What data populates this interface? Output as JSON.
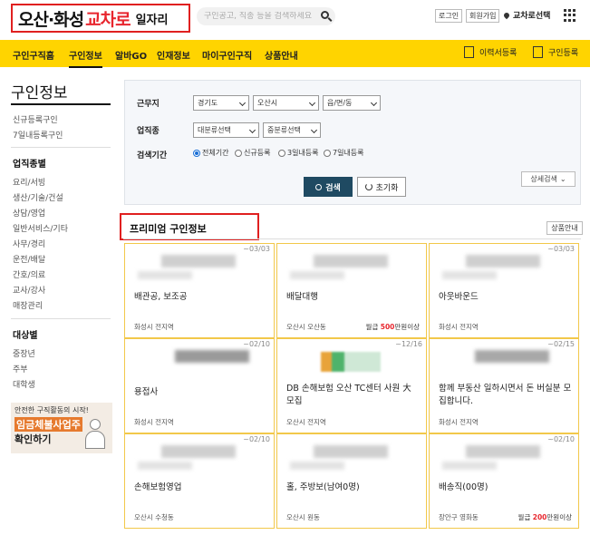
{
  "header": {
    "logo_main": "오산·화성",
    "logo_accent": "교차로",
    "logo_sub": "일자리",
    "search_placeholder": "구인공고, 직종 등을 검색하세요",
    "login": "로그인",
    "signup": "회원가입",
    "location": "교차로선택"
  },
  "nav": {
    "items": [
      "구인구직홈",
      "구인정보",
      "알바GO",
      "인재정보",
      "마이구인구직",
      "상품안내"
    ],
    "active_index": 1,
    "resume_register": "이력서등록",
    "job_register": "구인등록"
  },
  "sidebar": {
    "title": "구인정보",
    "links": [
      "신규등록구인",
      "7일내등록구인"
    ],
    "category_head": "업직종별",
    "categories": [
      "요리/서빙",
      "생산/기술/건설",
      "상담/영업",
      "일반서비스/기타",
      "사무/경리",
      "운전/배달",
      "간호/의료",
      "교사/강사",
      "매장관리"
    ],
    "target_head": "대상별",
    "targets": [
      "중장년",
      "주부",
      "대학생"
    ],
    "banner_line1": "안전한 구직활동의 시작!",
    "banner_line2": "임금체불사업주",
    "banner_line3": "확인하기"
  },
  "filter": {
    "region_label": "근무지",
    "region_1": "경기도",
    "region_2": "오산시",
    "region_3": "읍/면/동",
    "job_label": "업직종",
    "job_1": "대분류선택",
    "job_2": "중분류선택",
    "period_label": "검색기간",
    "periods": [
      "전체기간",
      "신규등록",
      "3일내등록",
      "7일내등록"
    ],
    "search_btn": "검색",
    "reset_btn": "초기화",
    "detail_btn": "상세검색"
  },
  "premium": {
    "title": "프리미엄 구인정보",
    "product_btn": "상품안내",
    "cards": [
      {
        "date": "~03/03",
        "title": "배관공, 보조공",
        "place": "화성시 전지역",
        "pay_prefix": "",
        "pay_amount": "",
        "pay_suffix": ""
      },
      {
        "date": "",
        "title": "배달대행",
        "place": "오산시 오산동",
        "pay_prefix": "월급 ",
        "pay_amount": "500",
        "pay_suffix": "만원이상"
      },
      {
        "date": "~03/03",
        "title": "아웃바운드",
        "place": "화성시 전지역",
        "pay_prefix": "",
        "pay_amount": "",
        "pay_suffix": ""
      },
      {
        "date": "~02/10",
        "title": "용접사",
        "place": "화성시 전지역",
        "pay_prefix": "",
        "pay_amount": "",
        "pay_suffix": ""
      },
      {
        "date": "~12/16",
        "title": "DB 손해보험 오산 TC센터 사원 大 모집",
        "place": "오산시 전지역",
        "pay_prefix": "",
        "pay_amount": "",
        "pay_suffix": ""
      },
      {
        "date": "~02/15",
        "title": "함께 부동산 일하시면서 돈 버실분 모집합니다.",
        "place": "화성시 전지역",
        "pay_prefix": "",
        "pay_amount": "",
        "pay_suffix": ""
      },
      {
        "date": "~02/10",
        "title": "손해보험영업",
        "place": "오산시 수청동",
        "pay_prefix": "",
        "pay_amount": "",
        "pay_suffix": ""
      },
      {
        "date": "",
        "title": "홀, 주방보(남여0명)",
        "place": "오산시 원동",
        "pay_prefix": "",
        "pay_amount": "",
        "pay_suffix": ""
      },
      {
        "date": "~02/10",
        "title": "배송직(00명)",
        "place": "장안구 영화동",
        "pay_prefix": "월급 ",
        "pay_amount": "200",
        "pay_suffix": "만원이상"
      }
    ]
  },
  "colors": {
    "accent_yellow": "#ffd400",
    "brand_red": "#e8262e",
    "search_btn": "#1f4a62"
  }
}
